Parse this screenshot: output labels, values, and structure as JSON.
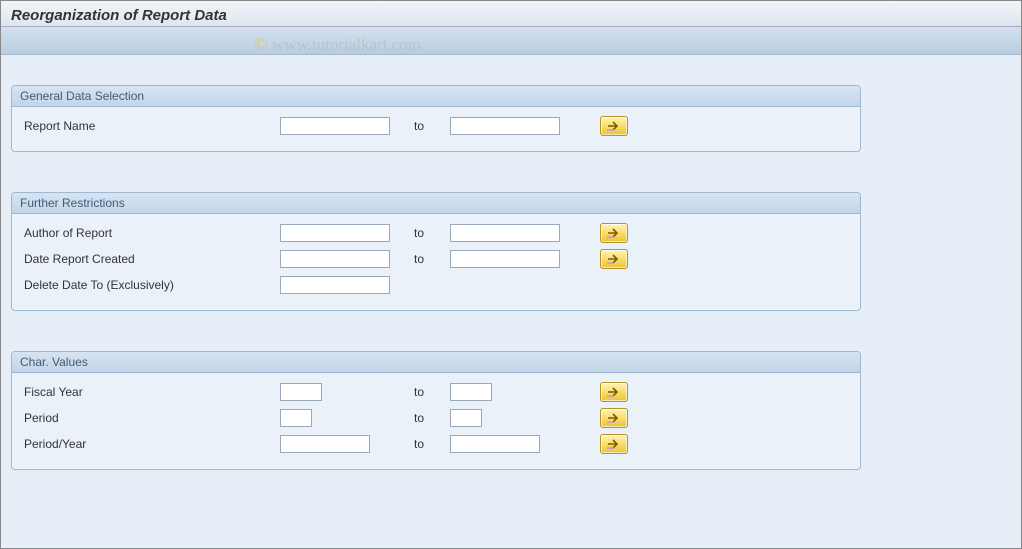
{
  "page_title": "Reorganization of Report Data",
  "watermark": "www.tutorialkart.com",
  "watermark_copy": "©",
  "groups": {
    "general": {
      "title": "General Data Selection",
      "rows": {
        "report_name": {
          "label": "Report Name",
          "to": "to",
          "from_val": "",
          "to_val": ""
        }
      }
    },
    "further": {
      "title": "Further Restrictions",
      "rows": {
        "author": {
          "label": "Author of Report",
          "to": "to",
          "from_val": "",
          "to_val": ""
        },
        "date_created": {
          "label": "Date Report Created",
          "to": "to",
          "from_val": "",
          "to_val": ""
        },
        "delete_date": {
          "label": "Delete Date To (Exclusively)",
          "val": ""
        }
      }
    },
    "char_values": {
      "title": "Char. Values",
      "rows": {
        "fiscal_year": {
          "label": "Fiscal Year",
          "to": "to",
          "from_val": "",
          "to_val": ""
        },
        "period": {
          "label": "Period",
          "to": "to",
          "from_val": "",
          "to_val": ""
        },
        "period_year": {
          "label": "Period/Year",
          "to": "to",
          "from_val": "",
          "to_val": ""
        }
      }
    }
  }
}
